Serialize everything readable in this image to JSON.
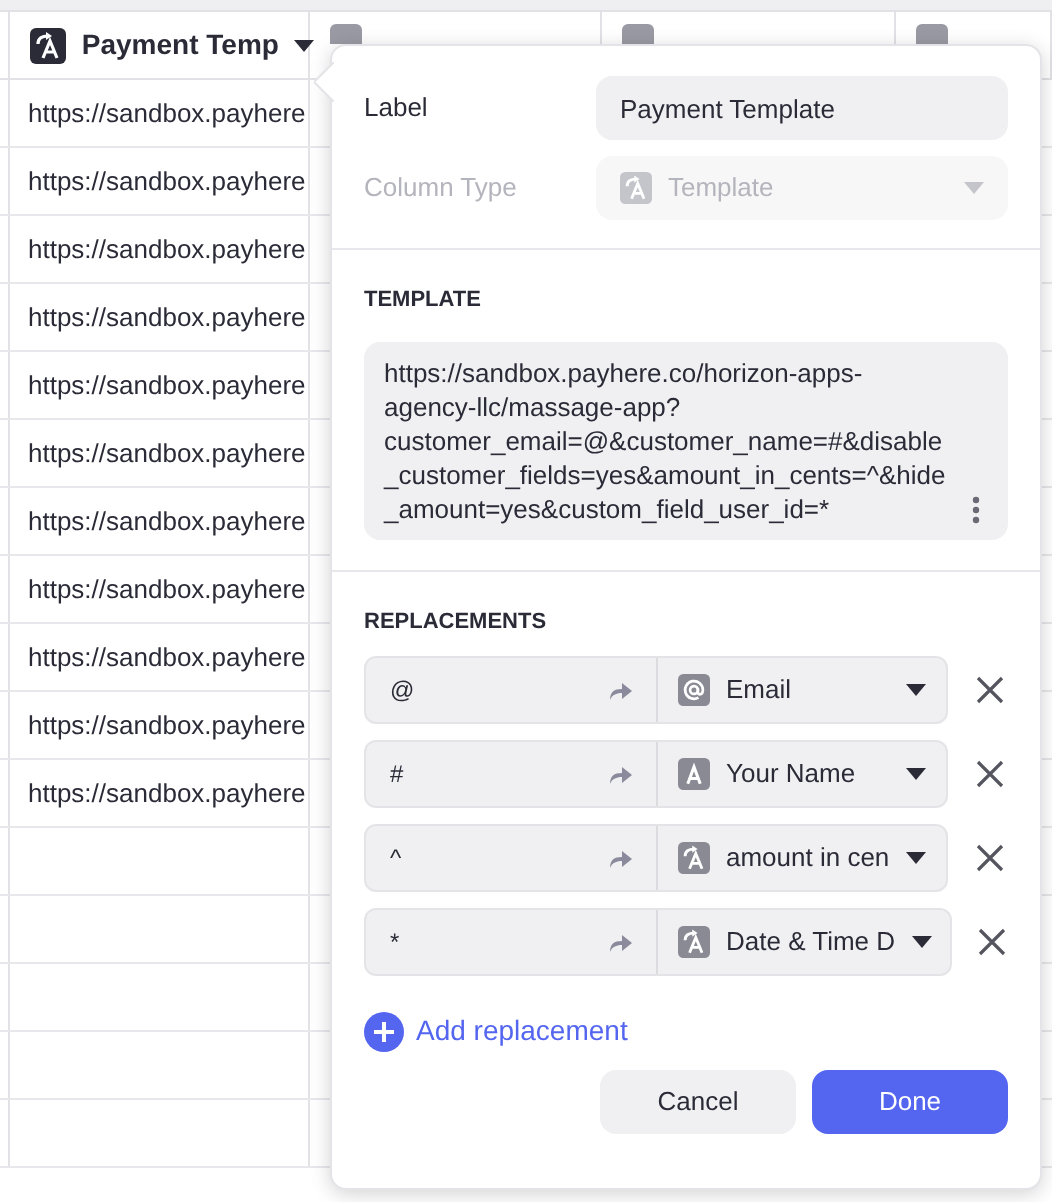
{
  "table": {
    "first_column": {
      "label": "Payment Temp",
      "kind": "template"
    },
    "rows": [
      "https://sandbox.payhere",
      "https://sandbox.payhere",
      "https://sandbox.payhere",
      "https://sandbox.payhere",
      "https://sandbox.payhere",
      "https://sandbox.payhere",
      "https://sandbox.payhere",
      "https://sandbox.payhere",
      "https://sandbox.payhere",
      "https://sandbox.payhere",
      "https://sandbox.payhere"
    ]
  },
  "editor": {
    "label_field": {
      "label": "Label",
      "value": "Payment Template"
    },
    "column_type": {
      "label": "Column Type",
      "value": "Template",
      "kind": "template",
      "disabled": true
    },
    "template": {
      "heading": "TEMPLATE",
      "text": "https://sandbox.payhere.co/horizon-apps-agency-llc/massage-app?customer_email=@&customer_name=#&disable_customer_fields=yes&amount_in_cents=^&hide_amount=yes&custom_field_user_id=*"
    },
    "replacements": {
      "heading": "REPLACEMENTS",
      "items": [
        {
          "token": "@",
          "column": "Email",
          "kind": "email"
        },
        {
          "token": "#",
          "column": "Your Name",
          "kind": "text"
        },
        {
          "token": "^",
          "column": "amount in cen",
          "kind": "template"
        },
        {
          "token": "*",
          "column": "Date & Time D",
          "kind": "template"
        }
      ],
      "add_label": "Add replacement"
    },
    "buttons": {
      "cancel": "Cancel",
      "done": "Done"
    }
  }
}
